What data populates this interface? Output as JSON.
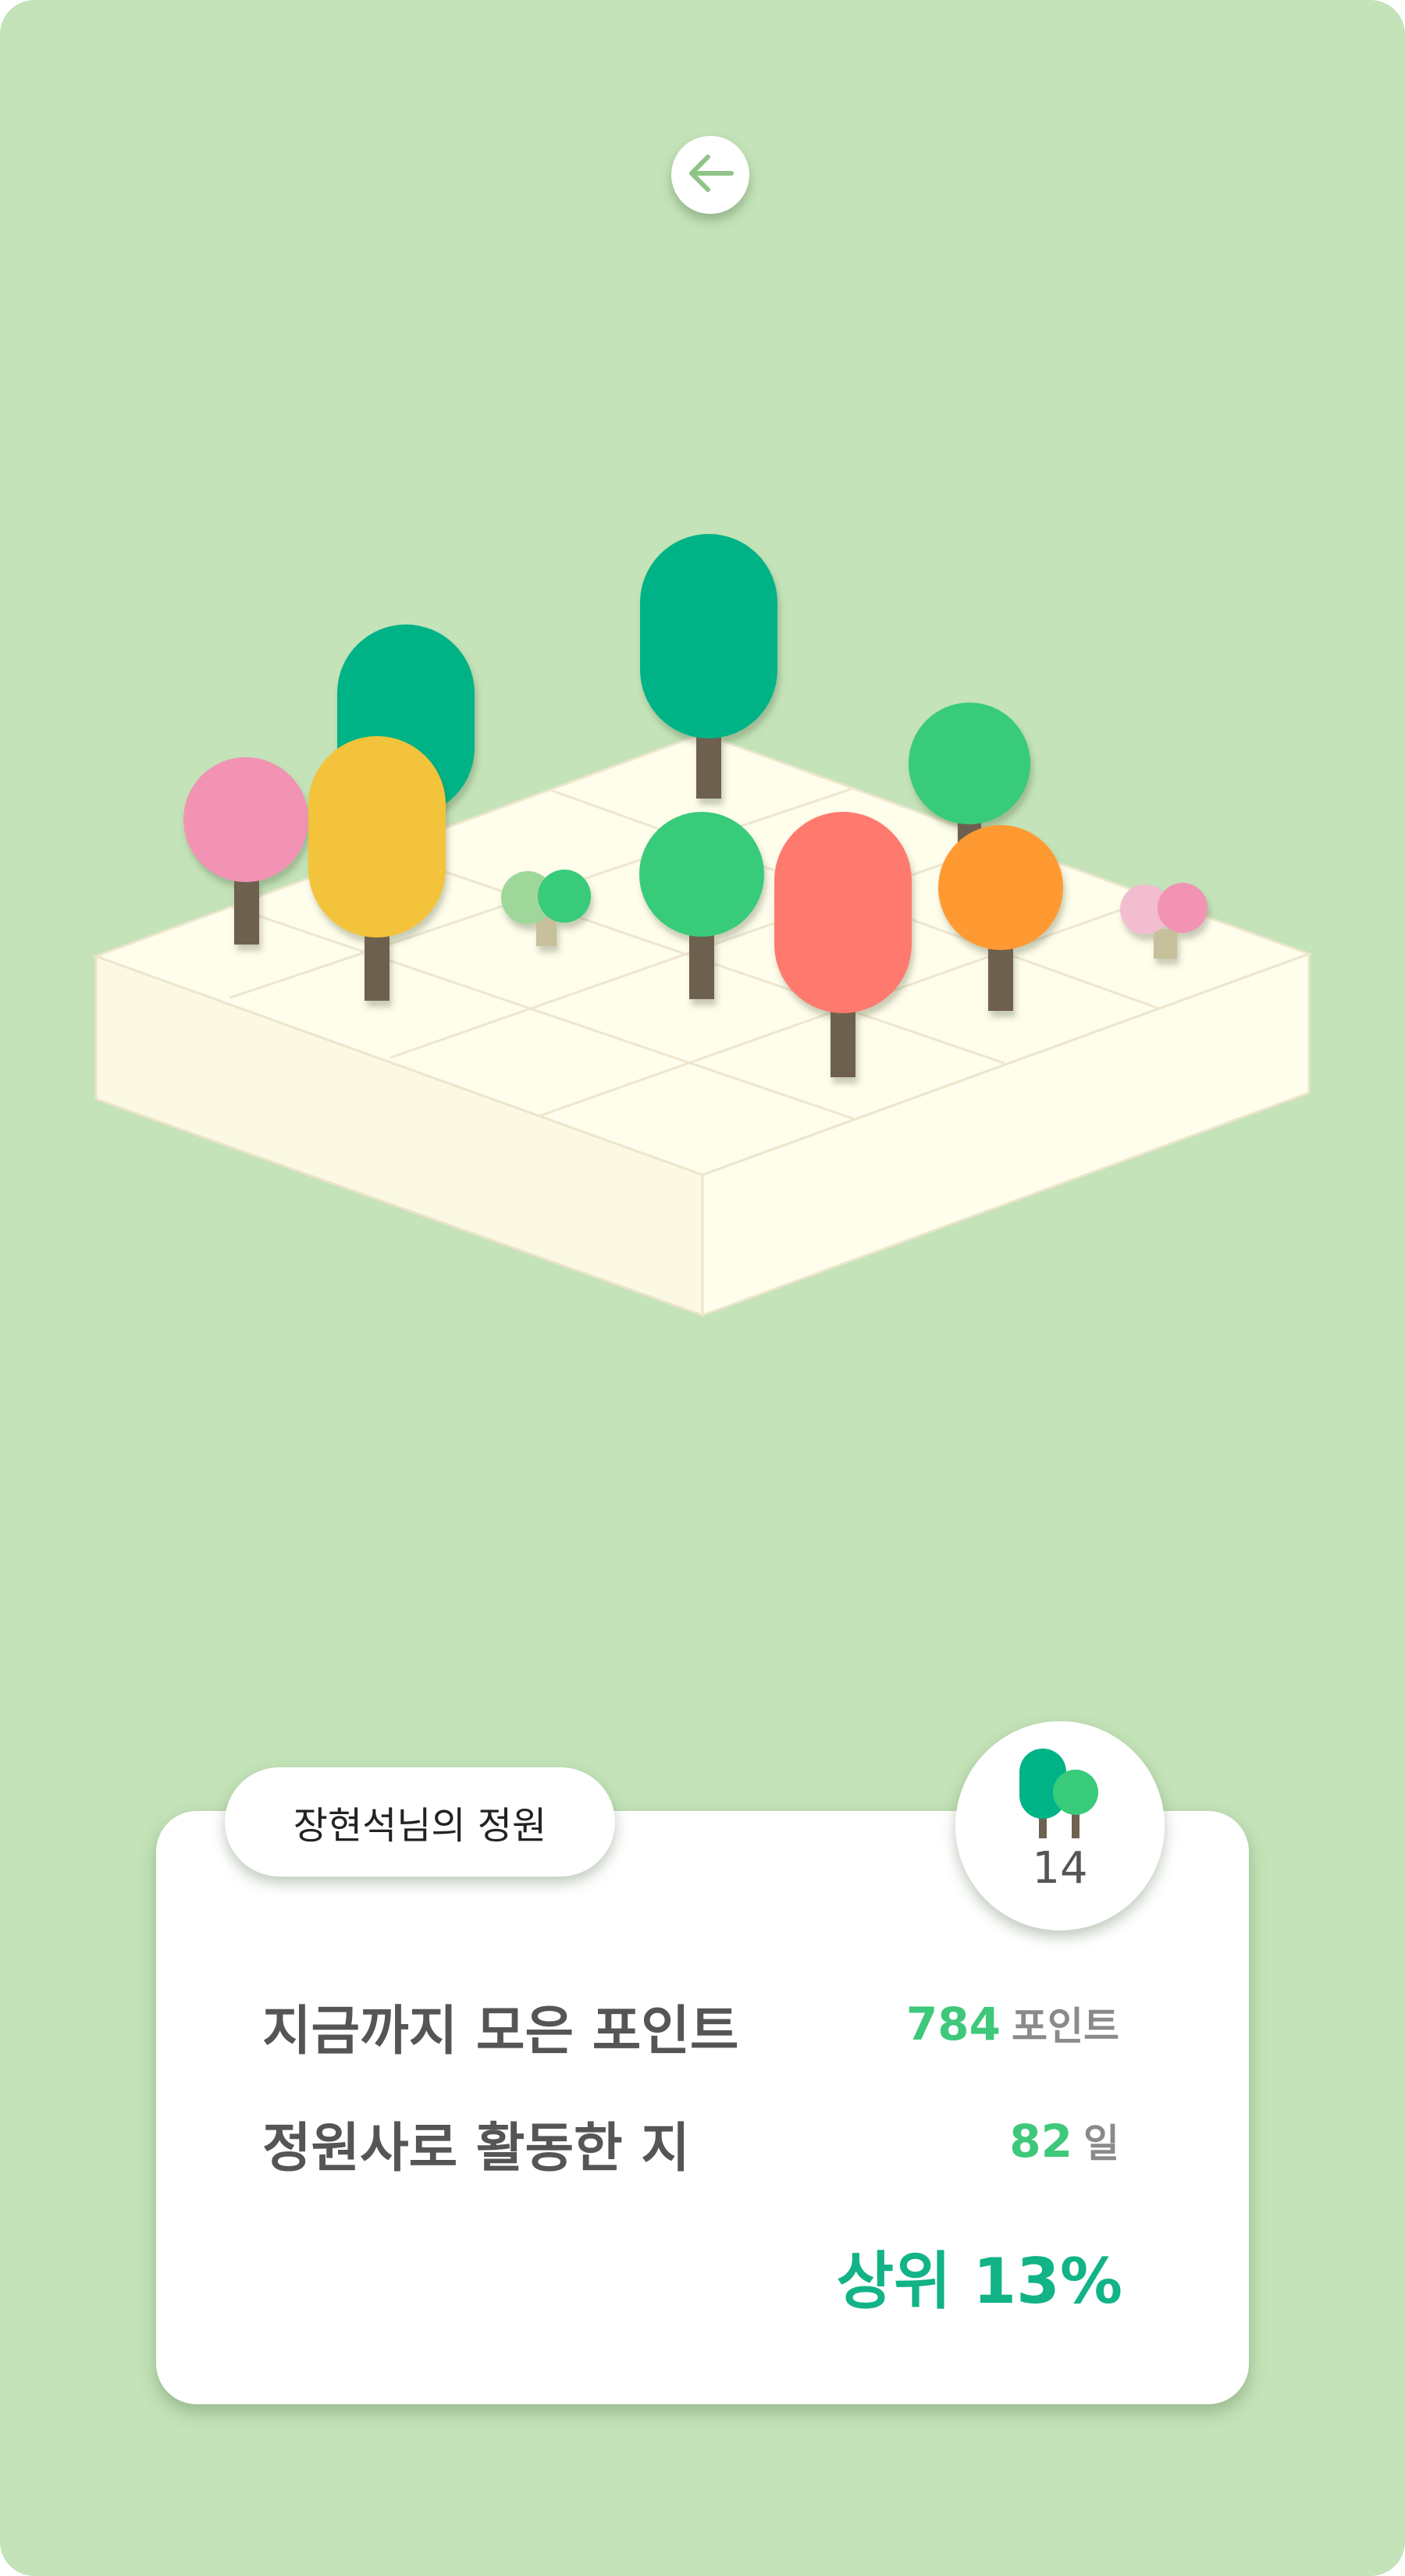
{
  "header": {
    "back_icon": "arrow-left-icon"
  },
  "garden": {
    "owner_title": "장현석님의 정원",
    "tree_count": "14",
    "colors": {
      "background": "#c4e3b8",
      "ground": "#fffdeb",
      "teal": "#00b386",
      "green": "#38cb7a",
      "pink": "#f293b4",
      "yellow": "#f3c33a",
      "red": "#ff7a6e",
      "orange": "#ff9a33",
      "trunk": "#6e6150"
    }
  },
  "stats": {
    "points_label": "지금까지 모은 포인트",
    "points_value": "784",
    "points_unit": "포인트",
    "days_label": "정원사로 활동한 지",
    "days_value": "82",
    "days_unit": "일",
    "rank_text": "상위 13%"
  }
}
